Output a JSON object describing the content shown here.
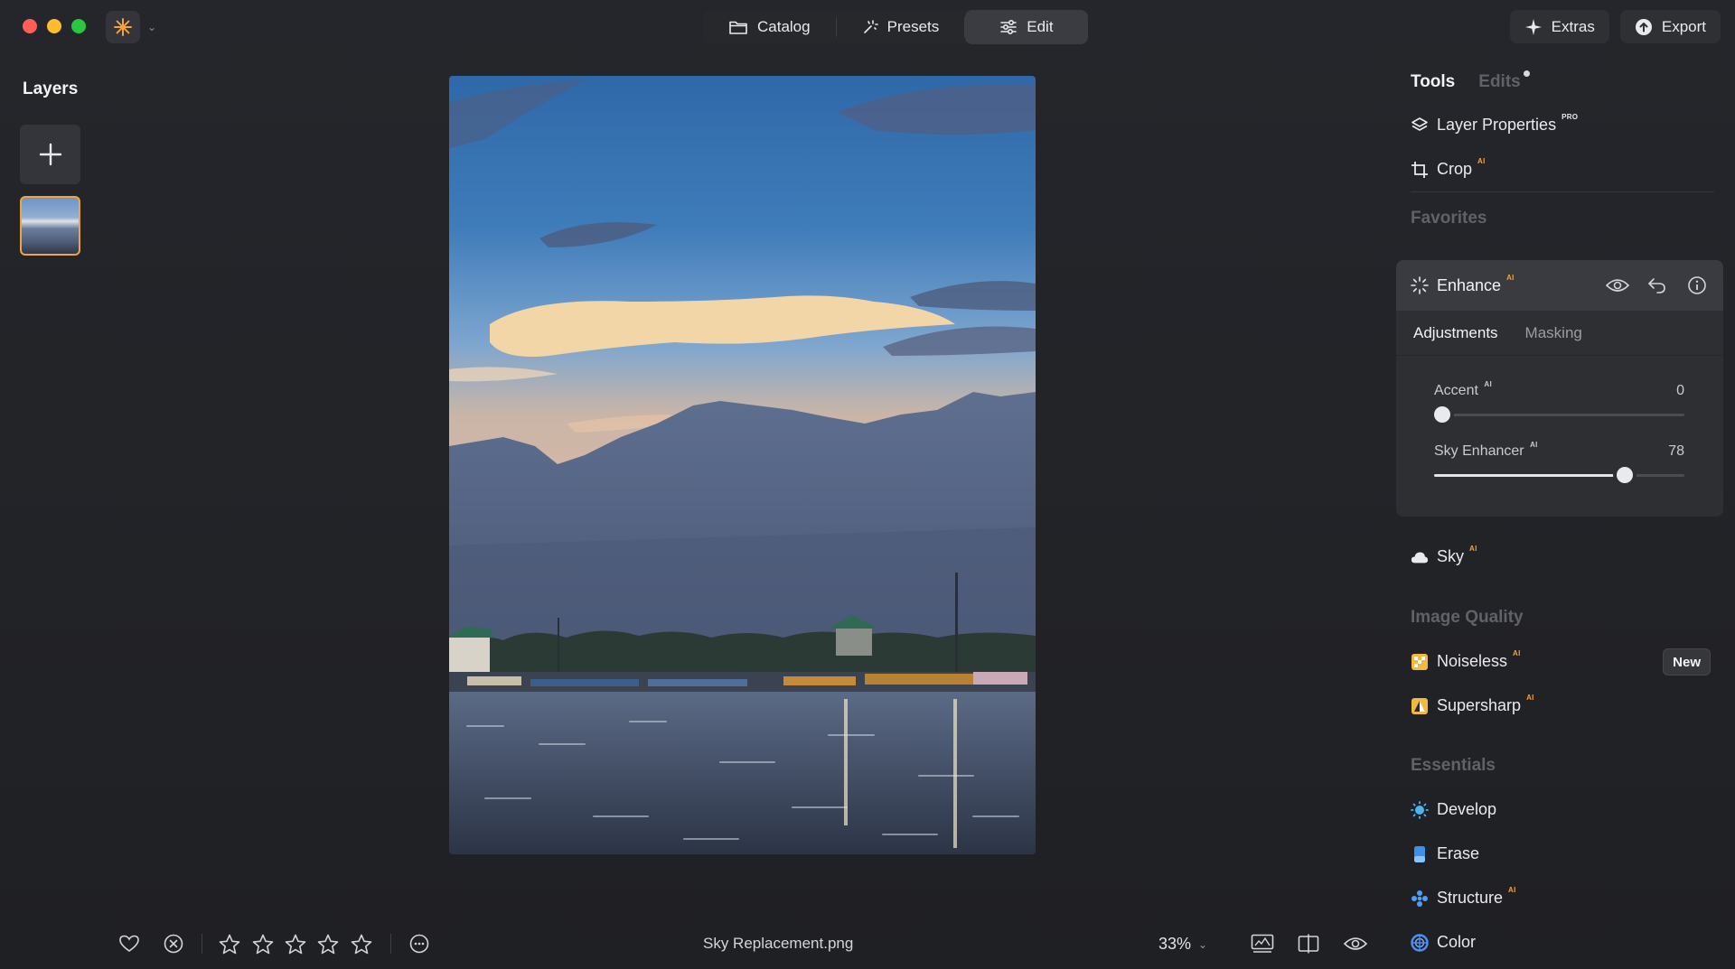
{
  "titlebar": {
    "tabs": [
      {
        "label": "Catalog",
        "icon": "folder-icon"
      },
      {
        "label": "Presets",
        "icon": "presets-icon"
      },
      {
        "label": "Edit",
        "icon": "sliders-icon",
        "active": true
      }
    ],
    "extras_label": "Extras",
    "export_label": "Export"
  },
  "layers": {
    "title": "Layers"
  },
  "right_panel": {
    "tabs": {
      "tools": "Tools",
      "edits": "Edits"
    },
    "layer_properties": {
      "label": "Layer Properties",
      "badge": "PRO"
    },
    "crop": {
      "label": "Crop",
      "badge": "AI"
    },
    "favorites_head": "Favorites",
    "enhance": {
      "label": "Enhance",
      "badge": "AI",
      "subtabs": {
        "adjustments": "Adjustments",
        "masking": "Masking"
      },
      "sliders": [
        {
          "label": "Accent",
          "badge": "AI",
          "value": "0",
          "fraction": 0.0
        },
        {
          "label": "Sky Enhancer",
          "badge": "AI",
          "value": "78",
          "fraction": 0.78
        }
      ]
    },
    "sky": {
      "label": "Sky",
      "badge": "AI"
    },
    "image_quality_head": "Image Quality",
    "noiseless": {
      "label": "Noiseless",
      "badge": "AI",
      "tag": "New"
    },
    "supersharp": {
      "label": "Supersharp",
      "badge": "AI"
    },
    "essentials_head": "Essentials",
    "develop": {
      "label": "Develop"
    },
    "erase": {
      "label": "Erase"
    },
    "structure": {
      "label": "Structure",
      "badge": "AI"
    },
    "color": {
      "label": "Color"
    }
  },
  "bottom_bar": {
    "filename": "Sky Replacement.png",
    "zoom": "33%",
    "rating_stars": 5
  },
  "colors": {
    "accent": "#f2a33a",
    "background": "#202226",
    "panel": "#2d2f33"
  }
}
